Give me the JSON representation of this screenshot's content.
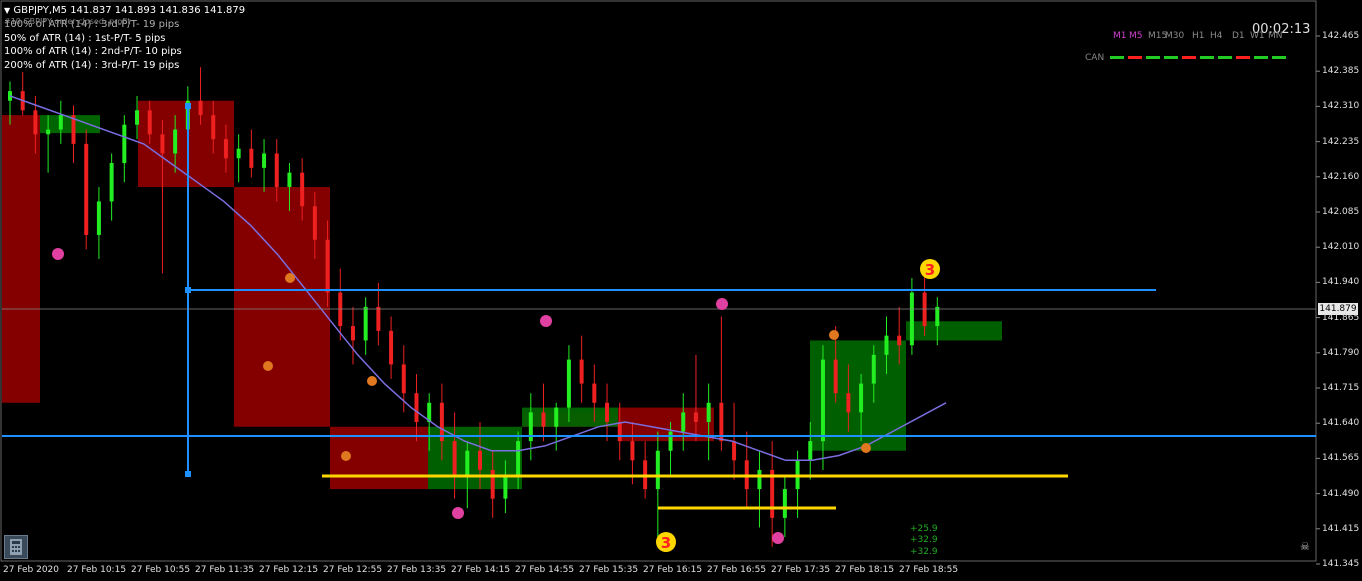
{
  "window": {
    "symbol_line": "GBPJPY,M5  141.837 141.893 141.836 141.879",
    "menu_icon": "triangle-down-icon"
  },
  "overlay_texts": [
    "100% of ATR (14) : 3rd-P/T- 19 pips",
    "50% of ATR (14) : 1st-P/T- 5 pips",
    "100% of ATR (14) : 2nd-P/T- 10 pips",
    "200% of ATR (14) : 3rd-P/T- 19 pips"
  ],
  "ghost_text": "#10 GBPJPY order closed: profit",
  "timeframes": [
    "M1",
    "M5",
    "M15",
    "M30",
    "H1",
    "H4",
    "D1",
    "W1",
    "MN"
  ],
  "active_timeframe": "M5",
  "timer": "00:02:13",
  "can_label": "CAN",
  "current_price": "141.879",
  "price_axis": [
    "142.465",
    "142.385",
    "142.310",
    "142.235",
    "142.160",
    "142.085",
    "142.010",
    "141.940",
    "141.865",
    "141.790",
    "141.715",
    "141.640",
    "141.565",
    "141.490",
    "141.415",
    "141.345"
  ],
  "time_axis": [
    "27 Feb 2020",
    "27 Feb 10:15",
    "27 Feb 10:55",
    "27 Feb 11:35",
    "27 Feb 12:15",
    "27 Feb 12:55",
    "27 Feb 13:35",
    "27 Feb 14:15",
    "27 Feb 14:55",
    "27 Feb 15:35",
    "27 Feb 16:15",
    "27 Feb 16:55",
    "27 Feb 17:35",
    "27 Feb 18:15",
    "27 Feb 18:55"
  ],
  "profit_labels": [
    "+25.9",
    "+32.9",
    "+32.9"
  ],
  "markers": {
    "three_top": "3",
    "three_bottom": "3"
  },
  "colors": {
    "bg": "#000000",
    "bull": "#22ee22",
    "bear": "#ee2020",
    "red_box": "#8b0000",
    "green_box": "#006400",
    "blue_line": "#1e90ff",
    "yellow_line": "#ffd700",
    "ma": "#7a6ee0"
  },
  "chart_data": {
    "type": "candlestick",
    "symbol": "GBPJPY",
    "timeframe": "M5",
    "ylim": [
      141.345,
      142.465
    ],
    "last_price": 141.879,
    "ohlc_line": {
      "open": 141.837,
      "high": 141.893,
      "low": 141.836,
      "close": 141.879
    },
    "candles": [
      [
        142.33,
        142.37,
        142.28,
        142.35
      ],
      [
        142.35,
        142.39,
        142.3,
        142.31
      ],
      [
        142.31,
        142.34,
        142.22,
        142.26
      ],
      [
        142.26,
        142.3,
        142.18,
        142.27
      ],
      [
        142.27,
        142.33,
        142.24,
        142.3
      ],
      [
        142.3,
        142.32,
        142.2,
        142.24
      ],
      [
        142.24,
        142.27,
        142.02,
        142.05
      ],
      [
        142.05,
        142.15,
        142.0,
        142.12
      ],
      [
        142.12,
        142.22,
        142.08,
        142.2
      ],
      [
        142.2,
        142.3,
        142.16,
        142.28
      ],
      [
        142.28,
        142.34,
        142.25,
        142.31
      ],
      [
        142.31,
        142.33,
        142.24,
        142.26
      ],
      [
        142.26,
        142.29,
        141.97,
        142.22
      ],
      [
        142.22,
        142.3,
        142.18,
        142.27
      ],
      [
        142.27,
        142.36,
        142.24,
        142.33
      ],
      [
        142.33,
        142.4,
        142.28,
        142.3
      ],
      [
        142.3,
        142.33,
        142.22,
        142.25
      ],
      [
        142.25,
        142.28,
        142.18,
        142.21
      ],
      [
        142.21,
        142.26,
        142.16,
        142.23
      ],
      [
        142.23,
        142.27,
        142.17,
        142.19
      ],
      [
        142.19,
        142.25,
        142.14,
        142.22
      ],
      [
        142.22,
        142.25,
        142.12,
        142.15
      ],
      [
        142.15,
        142.2,
        142.1,
        142.18
      ],
      [
        142.18,
        142.21,
        142.08,
        142.11
      ],
      [
        142.11,
        142.14,
        142.0,
        142.04
      ],
      [
        142.04,
        142.08,
        141.9,
        141.93
      ],
      [
        141.93,
        141.98,
        141.83,
        141.86
      ],
      [
        141.86,
        141.9,
        141.78,
        141.83
      ],
      [
        141.83,
        141.92,
        141.8,
        141.9
      ],
      [
        141.9,
        141.95,
        141.82,
        141.85
      ],
      [
        141.85,
        141.88,
        141.75,
        141.78
      ],
      [
        141.78,
        141.82,
        141.68,
        141.72
      ],
      [
        141.72,
        141.76,
        141.62,
        141.66
      ],
      [
        141.66,
        141.72,
        141.6,
        141.7
      ],
      [
        141.7,
        141.74,
        141.58,
        141.62
      ],
      [
        141.62,
        141.68,
        141.5,
        141.55
      ],
      [
        141.55,
        141.62,
        141.48,
        141.6
      ],
      [
        141.6,
        141.66,
        141.52,
        141.56
      ],
      [
        141.56,
        141.6,
        141.46,
        141.5
      ],
      [
        141.5,
        141.58,
        141.47,
        141.55
      ],
      [
        141.55,
        141.64,
        141.52,
        141.62
      ],
      [
        141.62,
        141.72,
        141.58,
        141.68
      ],
      [
        141.68,
        141.74,
        141.62,
        141.65
      ],
      [
        141.65,
        141.7,
        141.6,
        141.69
      ],
      [
        141.69,
        141.82,
        141.66,
        141.79
      ],
      [
        141.79,
        141.84,
        141.7,
        141.74
      ],
      [
        141.74,
        141.78,
        141.66,
        141.7
      ],
      [
        141.7,
        141.74,
        141.62,
        141.66
      ],
      [
        141.66,
        141.7,
        141.58,
        141.62
      ],
      [
        141.62,
        141.66,
        141.53,
        141.58
      ],
      [
        141.58,
        141.62,
        141.5,
        141.52
      ],
      [
        141.52,
        141.64,
        141.42,
        141.6
      ],
      [
        141.6,
        141.66,
        141.55,
        141.64
      ],
      [
        141.64,
        141.72,
        141.6,
        141.68
      ],
      [
        141.68,
        141.8,
        141.62,
        141.66
      ],
      [
        141.66,
        141.74,
        141.58,
        141.7
      ],
      [
        141.7,
        141.88,
        141.6,
        141.62
      ],
      [
        141.62,
        141.7,
        141.54,
        141.58
      ],
      [
        141.58,
        141.64,
        141.48,
        141.52
      ],
      [
        141.52,
        141.6,
        141.44,
        141.56
      ],
      [
        141.56,
        141.62,
        141.4,
        141.46
      ],
      [
        141.46,
        141.55,
        141.42,
        141.52
      ],
      [
        141.52,
        141.6,
        141.46,
        141.58
      ],
      [
        141.58,
        141.66,
        141.54,
        141.62
      ],
      [
        141.62,
        141.82,
        141.56,
        141.79
      ],
      [
        141.79,
        141.86,
        141.7,
        141.72
      ],
      [
        141.72,
        141.78,
        141.64,
        141.68
      ],
      [
        141.68,
        141.76,
        141.62,
        141.74
      ],
      [
        141.74,
        141.82,
        141.7,
        141.8
      ],
      [
        141.8,
        141.88,
        141.76,
        141.84
      ],
      [
        141.84,
        141.9,
        141.78,
        141.82
      ],
      [
        141.82,
        141.96,
        141.8,
        141.93
      ],
      [
        141.93,
        141.97,
        141.84,
        141.86
      ],
      [
        141.86,
        141.92,
        141.82,
        141.9
      ]
    ],
    "levels": {
      "blue_top": 141.92,
      "blue_bottom": 141.6,
      "yellow_long": 141.52,
      "yellow_short": 141.455
    },
    "ma_series": [
      142.34,
      142.32,
      142.3,
      142.28,
      142.26,
      142.24,
      142.2,
      142.16,
      142.12,
      142.07,
      142.01,
      141.94,
      141.87,
      141.8,
      141.74,
      141.69,
      141.65,
      141.62,
      141.6,
      141.6,
      141.61,
      141.63,
      141.65,
      141.66,
      141.65,
      141.64,
      141.63,
      141.62,
      141.6,
      141.58,
      141.58,
      141.59,
      141.61,
      141.64,
      141.67,
      141.7
    ],
    "boxes": [
      {
        "type": "red",
        "from": 141.7,
        "to": 142.3
      },
      {
        "type": "red",
        "from": 142.15,
        "to": 142.33
      },
      {
        "type": "red",
        "from": 141.65,
        "to": 142.15
      },
      {
        "type": "red",
        "from": 141.52,
        "to": 141.65
      },
      {
        "type": "green",
        "from": 141.52,
        "to": 141.65
      },
      {
        "type": "red",
        "from": 141.65,
        "to": 141.68
      },
      {
        "type": "green",
        "from": 141.65,
        "to": 141.69
      },
      {
        "type": "red",
        "from": 141.62,
        "to": 141.69
      },
      {
        "type": "green",
        "from": 141.6,
        "to": 141.83
      },
      {
        "type": "green",
        "from": 141.83,
        "to": 141.87
      }
    ]
  }
}
